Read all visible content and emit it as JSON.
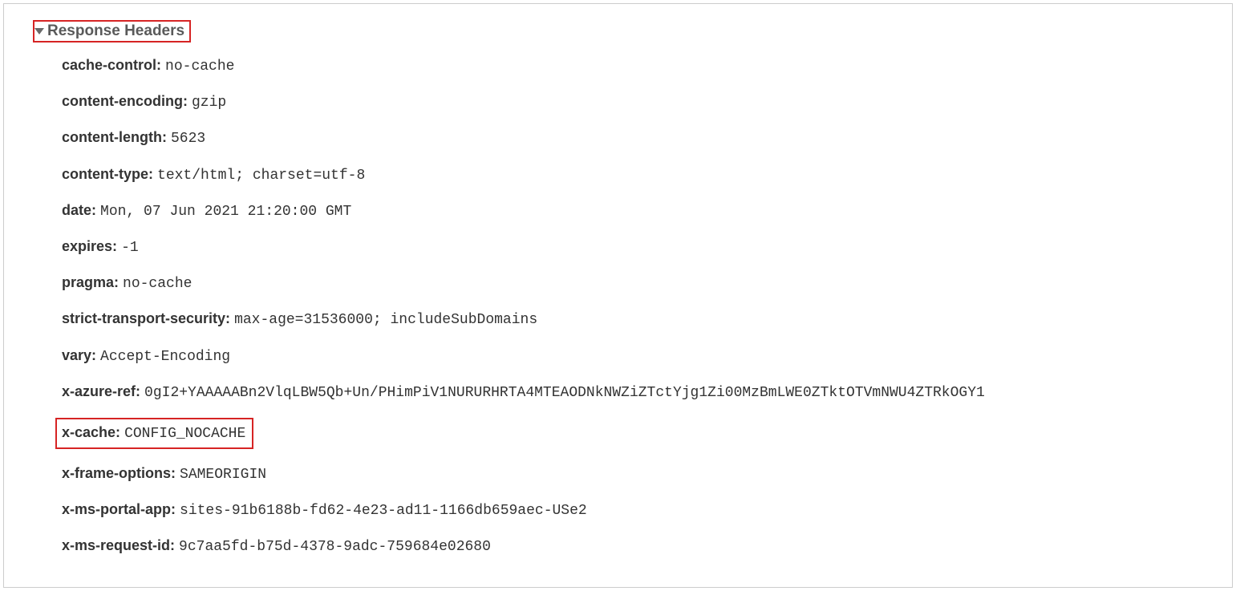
{
  "section": {
    "title": "Response Headers"
  },
  "headers": {
    "cache_control": {
      "name": "cache-control:",
      "value": "no-cache"
    },
    "content_encoding": {
      "name": "content-encoding:",
      "value": "gzip"
    },
    "content_length": {
      "name": "content-length:",
      "value": "5623"
    },
    "content_type": {
      "name": "content-type:",
      "value": "text/html; charset=utf-8"
    },
    "date": {
      "name": "date:",
      "value": "Mon, 07 Jun 2021 21:20:00 GMT"
    },
    "expires": {
      "name": "expires:",
      "value": "-1"
    },
    "pragma": {
      "name": "pragma:",
      "value": "no-cache"
    },
    "sts": {
      "name": "strict-transport-security:",
      "value": "max-age=31536000; includeSubDomains"
    },
    "vary": {
      "name": "vary:",
      "value": "Accept-Encoding"
    },
    "x_azure_ref": {
      "name": "x-azure-ref:",
      "value": "0gI2+YAAAAABn2VlqLBW5Qb+Un/PHimPiV1NURURHRTA4MTEAODNkNWZiZTctYjg1Zi00MzBmLWE0ZTktOTVmNWU4ZTRkOGY1"
    },
    "x_cache": {
      "name": "x-cache:",
      "value": "CONFIG_NOCACHE"
    },
    "x_frame_options": {
      "name": "x-frame-options:",
      "value": "SAMEORIGIN"
    },
    "x_ms_portal_app": {
      "name": "x-ms-portal-app:",
      "value": "sites-91b6188b-fd62-4e23-ad11-1166db659aec-USe2"
    },
    "x_ms_request_id": {
      "name": "x-ms-request-id:",
      "value": "9c7aa5fd-b75d-4378-9adc-759684e02680"
    }
  }
}
